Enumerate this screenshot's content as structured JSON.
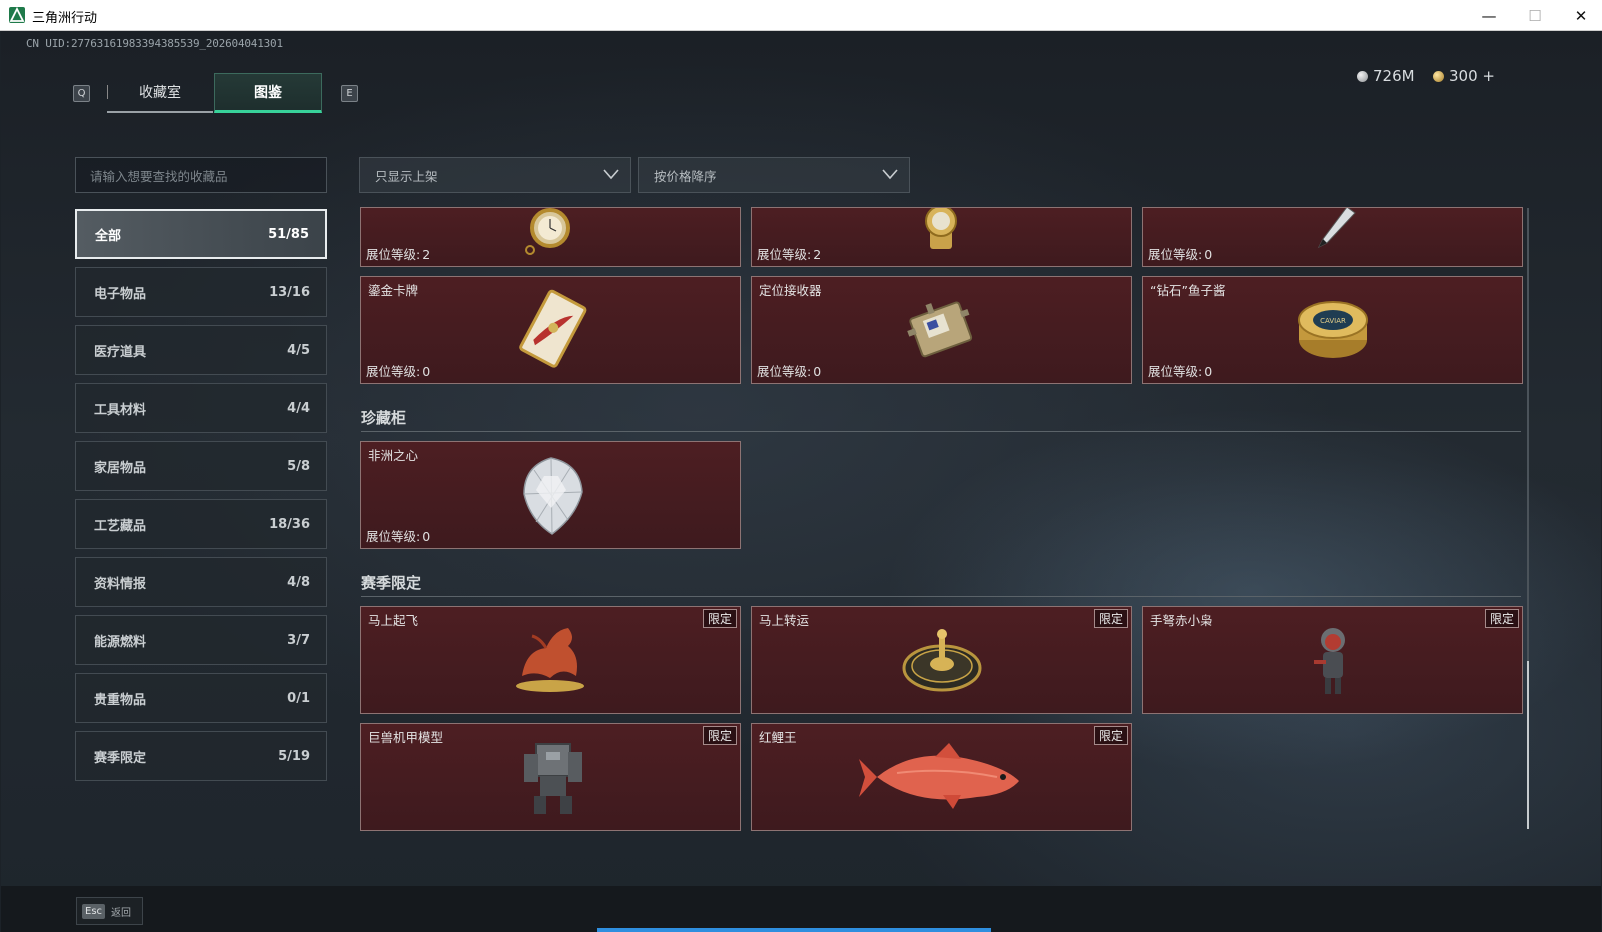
{
  "window": {
    "title": "三角洲行动",
    "minimize": "—",
    "maximize": "☐",
    "close": "✕"
  },
  "header": {
    "uid": "CN UID:2776316198339438553​9_202604041301",
    "tab_prev_key": "Q",
    "tab_next_key": "E",
    "tabs": [
      {
        "label": "收藏室",
        "active": false
      },
      {
        "label": "图鉴",
        "active": true
      }
    ],
    "currency": [
      {
        "icon": "silver-coin-icon",
        "value": "726M"
      },
      {
        "icon": "gold-coin-icon",
        "value": "300 +"
      }
    ]
  },
  "search": {
    "placeholder": "请输入想要查找的收藏品"
  },
  "filters": [
    {
      "label": "只显示上架"
    },
    {
      "label": "按价格降序"
    }
  ],
  "categories": [
    {
      "label": "全部",
      "count": "51/85",
      "active": true
    },
    {
      "label": "电子物品",
      "count": "13/16"
    },
    {
      "label": "医疗道具",
      "count": "4/5"
    },
    {
      "label": "工具材料",
      "count": "4/4"
    },
    {
      "label": "家居物品",
      "count": "5/8"
    },
    {
      "label": "工艺藏品",
      "count": "18/36"
    },
    {
      "label": "资料情报",
      "count": "4/8"
    },
    {
      "label": "能源燃料",
      "count": "3/7"
    },
    {
      "label": "贵重物品",
      "count": "0/1"
    },
    {
      "label": "赛季限定",
      "count": "5/19"
    }
  ],
  "level_label": "展位等级:",
  "cards_top": [
    {
      "name": "",
      "level": "2",
      "icon": "pocket-watch-icon"
    },
    {
      "name": "",
      "level": "2",
      "icon": "gold-watch-icon"
    },
    {
      "name": "",
      "level": "0",
      "icon": "fountain-pen-icon"
    },
    {
      "name": "鎏金卡牌",
      "level": "0",
      "icon": "gilded-card-icon"
    },
    {
      "name": "定位接收器",
      "level": "0",
      "icon": "gps-receiver-icon"
    },
    {
      "name": "“钻石”鱼子酱",
      "level": "0",
      "icon": "caviar-tin-icon",
      "tin_text": "CAVIAR"
    }
  ],
  "sections": [
    {
      "title": "珍藏柜",
      "cards": [
        {
          "name": "非洲之心",
          "level": "0",
          "icon": "diamond-icon"
        }
      ]
    },
    {
      "title": "赛季限定",
      "cards": [
        {
          "name": "马上起飞",
          "badge": "限定",
          "icon": "horse-statue-icon"
        },
        {
          "name": "马上转运",
          "badge": "限定",
          "icon": "lucky-dial-icon"
        },
        {
          "name": "手弩赤小枭",
          "badge": "限定",
          "icon": "crossbow-figure-icon"
        },
        {
          "name": "巨兽机甲模型",
          "badge": "限定",
          "icon": "mech-model-icon"
        },
        {
          "name": "红鲤王",
          "badge": "限定",
          "icon": "red-carp-icon"
        }
      ]
    }
  ],
  "footer": {
    "esc_key": "Esc",
    "back_label": "返回"
  }
}
